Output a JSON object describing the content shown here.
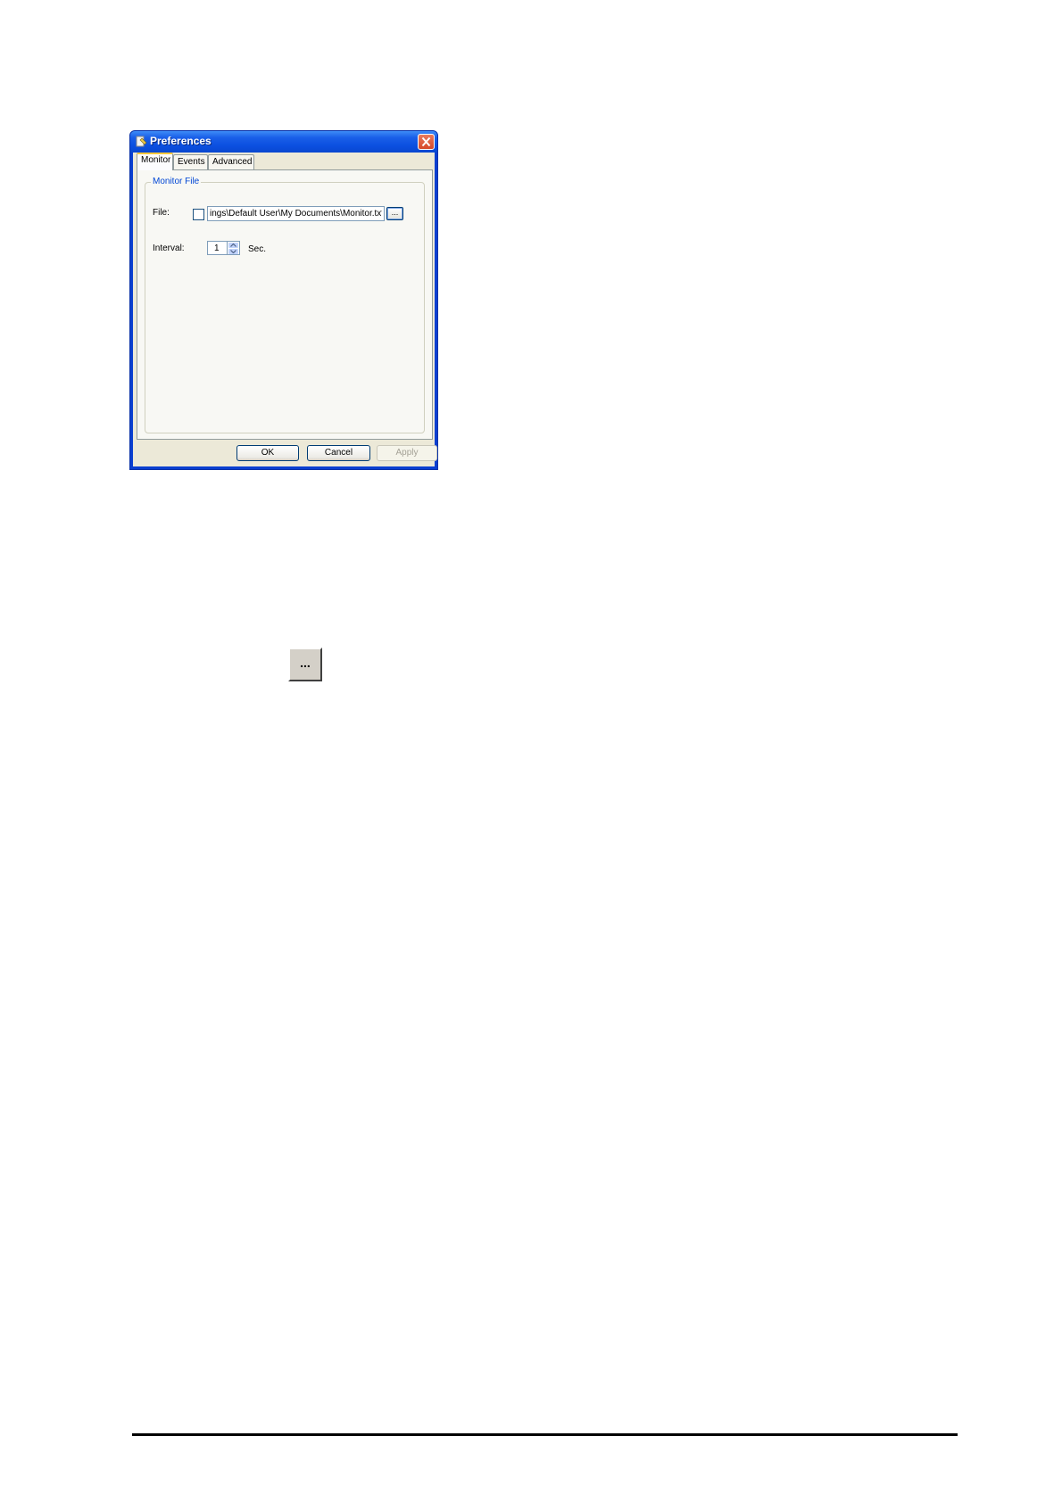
{
  "dialog": {
    "title": "Preferences",
    "close_icon": "close-icon",
    "tabs": [
      {
        "label": "Monitor",
        "active": true
      },
      {
        "label": "Events",
        "active": false
      },
      {
        "label": "Advanced",
        "active": false
      }
    ],
    "group_title": "Monitor File",
    "file_label": "File:",
    "file_checked": false,
    "file_path": "ings\\Default User\\My Documents\\Monitor.txt",
    "browse_label": "...",
    "interval_label": "Interval:",
    "interval_value": "1",
    "interval_unit": "Sec.",
    "buttons": {
      "ok": "OK",
      "cancel": "Cancel",
      "apply": "Apply"
    }
  },
  "browse_button_large": {
    "label": "..."
  }
}
